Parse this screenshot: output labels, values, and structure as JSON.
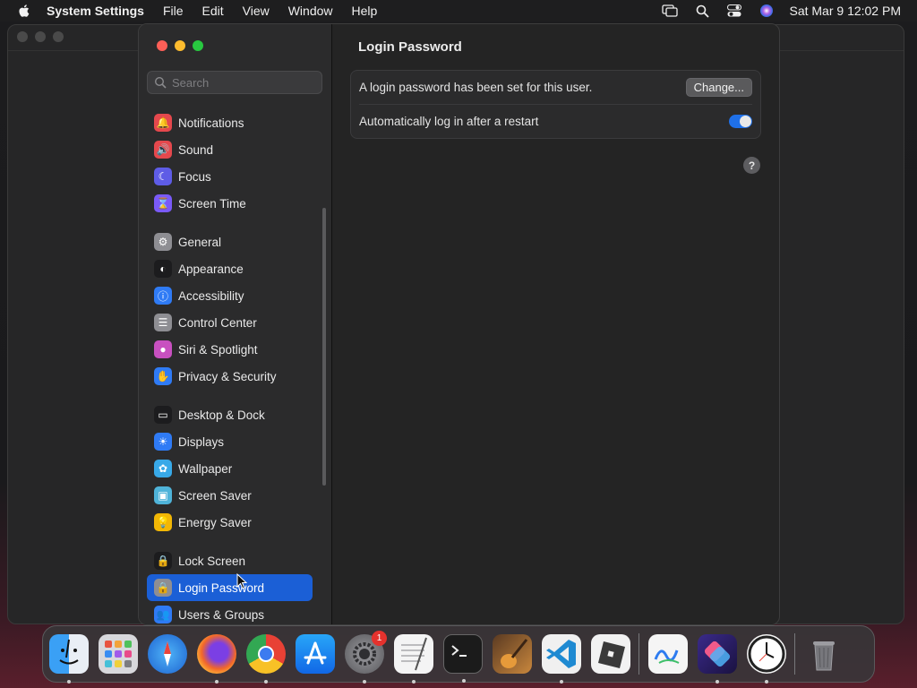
{
  "menubar": {
    "app_name": "System Settings",
    "items": [
      "File",
      "Edit",
      "View",
      "Window",
      "Help"
    ],
    "clock": "Sat Mar 9  12:02 PM"
  },
  "window": {
    "search_placeholder": "Search",
    "sidebar": {
      "groups": [
        [
          {
            "label": "Notifications",
            "icon": "bell-icon",
            "color": "#e5484d"
          },
          {
            "label": "Sound",
            "icon": "speaker-icon",
            "color": "#e5484d"
          },
          {
            "label": "Focus",
            "icon": "moon-icon",
            "color": "#5e5ce6"
          },
          {
            "label": "Screen Time",
            "icon": "hourglass-icon",
            "color": "#7a5af8"
          }
        ],
        [
          {
            "label": "General",
            "icon": "gear-icon",
            "color": "#8e8e93"
          },
          {
            "label": "Appearance",
            "icon": "appearance-icon",
            "color": "#1c1c1e"
          },
          {
            "label": "Accessibility",
            "icon": "accessibility-icon",
            "color": "#2f7bf5"
          },
          {
            "label": "Control Center",
            "icon": "control-center-icon",
            "color": "#8e8e93"
          },
          {
            "label": "Siri & Spotlight",
            "icon": "siri-icon",
            "color": "#c850c0"
          },
          {
            "label": "Privacy & Security",
            "icon": "hand-icon",
            "color": "#2f7bf5"
          }
        ],
        [
          {
            "label": "Desktop & Dock",
            "icon": "dock-icon",
            "color": "#1c1c1e"
          },
          {
            "label": "Displays",
            "icon": "sun-icon",
            "color": "#2f7bf5"
          },
          {
            "label": "Wallpaper",
            "icon": "flower-icon",
            "color": "#38a9e8"
          },
          {
            "label": "Screen Saver",
            "icon": "screen-saver-icon",
            "color": "#4fb3d9"
          },
          {
            "label": "Energy Saver",
            "icon": "bulb-icon",
            "color": "#f2b705"
          }
        ],
        [
          {
            "label": "Lock Screen",
            "icon": "lock-screen-icon",
            "color": "#1c1c1e"
          },
          {
            "label": "Login Password",
            "icon": "lock-icon",
            "color": "#8e8e93",
            "selected": true
          },
          {
            "label": "Users & Groups",
            "icon": "users-icon",
            "color": "#2f7bf5"
          }
        ]
      ]
    },
    "content": {
      "title": "Login Password",
      "row1_text": "A login password has been set for this user.",
      "change_button": "Change...",
      "row2_text": "Automatically log in after a restart",
      "auto_login_enabled": true,
      "help_label": "?"
    }
  },
  "dock": {
    "apps": [
      "Finder",
      "Launchpad",
      "Safari",
      "Firefox",
      "Chrome",
      "App Store",
      "System Settings",
      "TextEdit",
      "Terminal",
      "GarageBand",
      "Visual Studio Code",
      "Roblox",
      "Freeform",
      "Shortcuts",
      "Clock",
      "Trash"
    ],
    "system_settings_badge": "1"
  }
}
